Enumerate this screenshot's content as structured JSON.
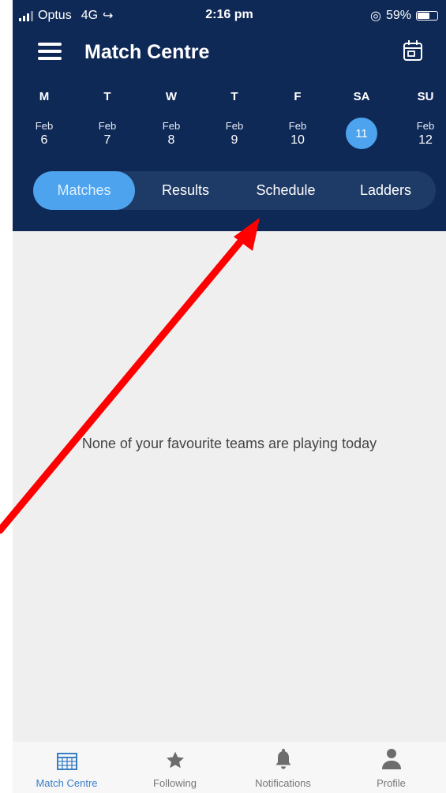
{
  "status_bar": {
    "carrier": "Optus",
    "network": "4G",
    "time": "2:16 pm",
    "battery": "59%",
    "battery_level": 0.59
  },
  "header": {
    "title": "Match Centre",
    "menu_icon": "hamburger-menu-icon",
    "calendar_icon": "calendar-icon"
  },
  "days": [
    {
      "day": "M",
      "month": "Feb",
      "date": "6"
    },
    {
      "day": "T",
      "month": "Feb",
      "date": "7"
    },
    {
      "day": "W",
      "month": "Feb",
      "date": "8"
    },
    {
      "day": "T",
      "month": "Feb",
      "date": "9"
    },
    {
      "day": "F",
      "month": "Feb",
      "date": "10"
    },
    {
      "day": "SA",
      "month": "",
      "date": "11",
      "selected": true
    },
    {
      "day": "SU",
      "month": "Feb",
      "date": "12"
    }
  ],
  "tabs": [
    {
      "label": "Matches",
      "active": true
    },
    {
      "label": "Results"
    },
    {
      "label": "Schedule"
    },
    {
      "label": "Ladders"
    }
  ],
  "content": {
    "empty_message": "None of your favourite teams are playing today"
  },
  "bottom_nav": [
    {
      "label": "Match Centre",
      "icon": "grid-calendar-icon",
      "active": true
    },
    {
      "label": "Following",
      "icon": "star-icon"
    },
    {
      "label": "Notifications",
      "icon": "bell-icon"
    },
    {
      "label": "Profile",
      "icon": "person-icon"
    }
  ],
  "colors": {
    "header_bg": "#0f2957",
    "accent": "#4da3ee",
    "content_bg": "#efefef",
    "annotation_arrow": "#ff0000"
  }
}
